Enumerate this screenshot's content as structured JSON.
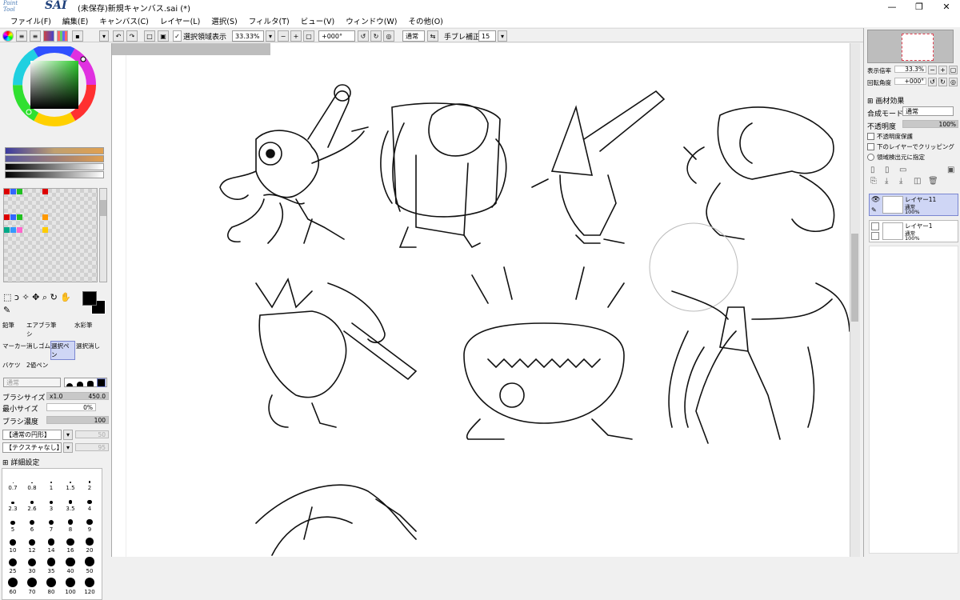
{
  "app": {
    "logo_small": "Paint Tool",
    "logo_big": "SAI",
    "title": "(未保存)新規キャンバス.sai (*)"
  },
  "window_buttons": {
    "min": "—",
    "max": "❐",
    "close": "✕"
  },
  "menu": [
    "ファイル(F)",
    "編集(E)",
    "キャンバス(C)",
    "レイヤー(L)",
    "選択(S)",
    "フィルタ(T)",
    "ビュー(V)",
    "ウィンドウ(W)",
    "その他(O)"
  ],
  "toolbar": {
    "selection_view": "選択領域表示",
    "zoom": "33.33%",
    "angle": "+000°",
    "blend": "通常",
    "stabilizer_label": "手ブレ補正",
    "stabilizer": "15"
  },
  "tools": {
    "row1": [
      "鉛筆",
      "エアブラシ",
      "筆",
      "水彩筆"
    ],
    "row2": [
      "マーカー",
      "消しゴム",
      "選択ペン",
      "選択消し"
    ],
    "row3": [
      "バケツ",
      "2値ペン"
    ],
    "active": "選択ペン"
  },
  "brush": {
    "mode": "通常",
    "size_label": "ブラシサイズ",
    "size_mult": "x1.0",
    "size": "450.0",
    "min_size_label": "最小サイズ",
    "min_size": "0%",
    "density_label": "ブラシ濃度",
    "density": "100",
    "shape": "【通常の円形】",
    "shape_val": "50",
    "texture": "【テクスチャなし】",
    "texture_val": "95",
    "detail": "詳細設定"
  },
  "brush_sizes": [
    "0.7",
    "0.8",
    "1",
    "1.5",
    "2",
    "2.3",
    "2.6",
    "3",
    "3.5",
    "4",
    "5",
    "6",
    "7",
    "8",
    "9",
    "10",
    "12",
    "14",
    "16",
    "20",
    "25",
    "30",
    "35",
    "40",
    "50",
    "60",
    "70",
    "80",
    "100",
    "120"
  ],
  "navigator": {
    "zoom_label": "表示倍率",
    "zoom": "33.3%",
    "angle_label": "回転角度",
    "angle": "+000°"
  },
  "layer_panel": {
    "effects": "画材効果",
    "blend_label": "合成モード",
    "blend": "通常",
    "opacity_label": "不透明度",
    "opacity": "100%",
    "protect": "不透明度保護",
    "clip": "下のレイヤーでクリッピング",
    "select_src": "領域検出元に指定",
    "layers": [
      {
        "name": "レイヤー11",
        "mode": "通常",
        "opacity": "100%"
      },
      {
        "name": "レイヤー1",
        "mode": "通常",
        "opacity": "100%"
      }
    ]
  },
  "colors": {
    "accent": "#7a86d0",
    "canvas_bg": "#8a8a8a"
  }
}
